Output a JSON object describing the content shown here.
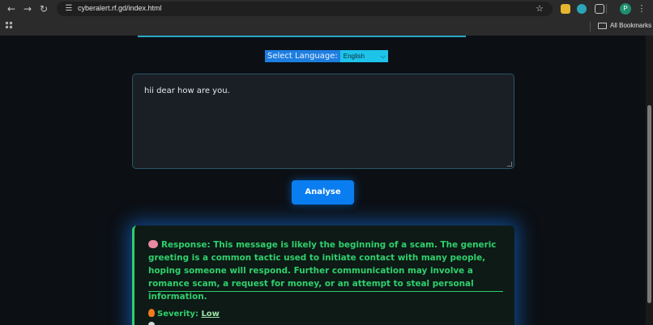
{
  "browser": {
    "url": "cyberalert.rf.gd/index.html",
    "bookmarks_label": "All Bookmarks",
    "profile_initial": "P"
  },
  "page": {
    "language_label": "Select Language:",
    "language_selected": "English",
    "message": "hii dear how are you.",
    "analyse_label": "Analyse",
    "response_label": "Response:",
    "response_text": "This message is likely the beginning of a scam. The generic greeting is a common tactic used to initiate contact with many people, hoping someone will respond. Further communication may involve a romance scam, a request for money, or an attempt to steal personal information.",
    "severity_label": "Severity:",
    "severity_value": "Low"
  },
  "colors": {
    "accent_blue": "#0a7df0",
    "result_green": "#2fd06c",
    "cyan": "#1ec3ea"
  }
}
